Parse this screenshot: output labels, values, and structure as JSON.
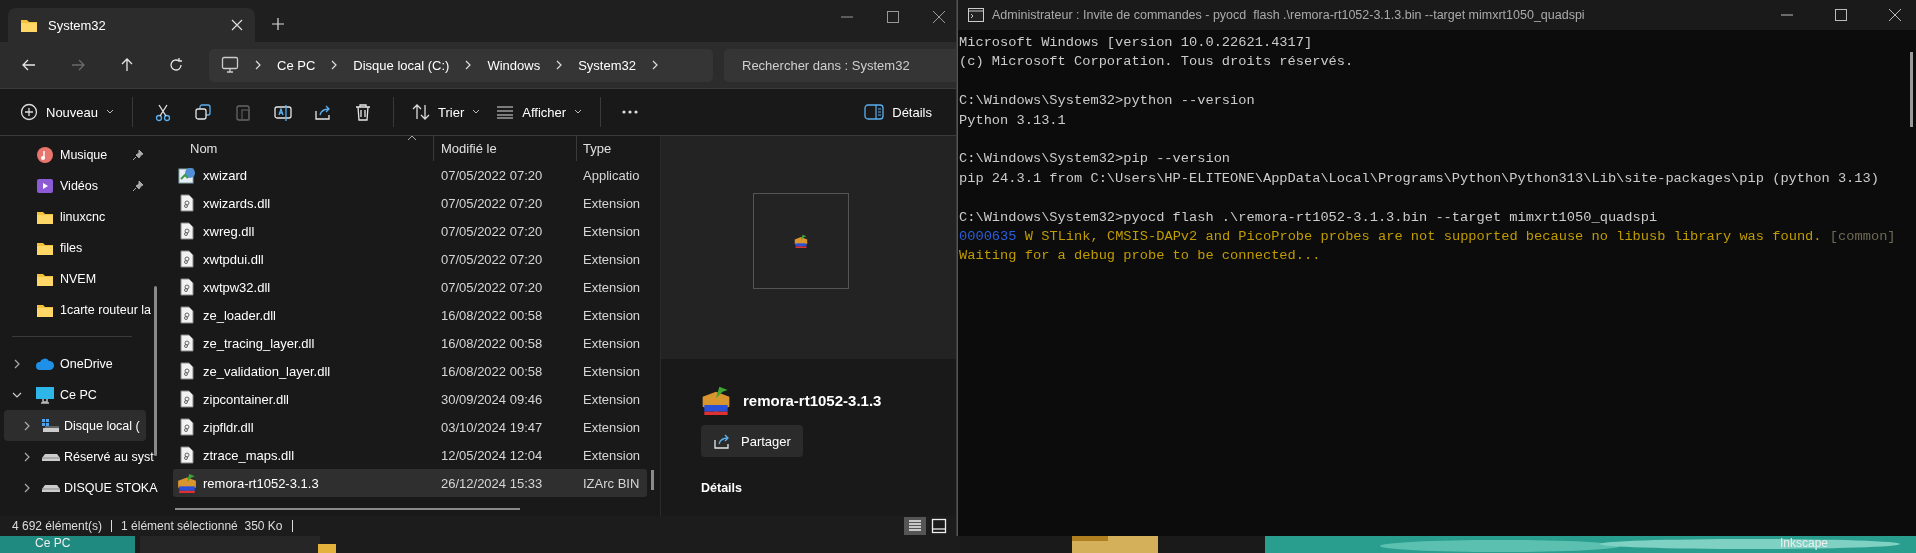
{
  "explorer": {
    "tab": {
      "title": "System32",
      "selected": true
    },
    "nav": [
      {
        "kind": "back",
        "disabled": false
      },
      {
        "kind": "forward",
        "disabled": true
      },
      {
        "kind": "up",
        "disabled": false
      },
      {
        "kind": "refresh",
        "disabled": false
      }
    ],
    "breadcrumb": [
      "Ce PC",
      "Disque local (C:)",
      "Windows",
      "System32"
    ],
    "search": {
      "placeholder": "Rechercher dans : System32"
    },
    "toolbar": {
      "new": "Nouveau",
      "sort": "Trier",
      "view": "Afficher",
      "details": "Détails",
      "actions": [
        {
          "kind": "cut",
          "disabled": false
        },
        {
          "kind": "copy",
          "disabled": false
        },
        {
          "kind": "paste",
          "disabled": true
        },
        {
          "kind": "rename",
          "disabled": false
        },
        {
          "kind": "share",
          "disabled": false
        },
        {
          "kind": "delete",
          "disabled": false
        }
      ]
    },
    "sidebar": {
      "quick_access": [
        {
          "label": "Musique",
          "kind": "music",
          "pinned": true,
          "selected": false
        },
        {
          "label": "Vidéos",
          "kind": "video",
          "pinned": true,
          "selected": false
        },
        {
          "label": "linuxcnc",
          "kind": "folder",
          "pinned": false,
          "selected": false
        },
        {
          "label": "files",
          "kind": "folder",
          "pinned": false,
          "selected": false
        },
        {
          "label": "NVEM",
          "kind": "folder",
          "pinned": false,
          "selected": false
        },
        {
          "label": "1carte routeur la",
          "kind": "folder",
          "pinned": false,
          "selected": false
        }
      ],
      "tree": [
        {
          "label": "OneDrive",
          "kind": "cloud",
          "expanded": false,
          "selected": false
        },
        {
          "label": "Ce PC",
          "kind": "pc",
          "expanded": true,
          "selected": false,
          "children": [
            {
              "label": "Disque local (",
              "kind": "system-drive",
              "expanded": false,
              "selected": true
            },
            {
              "label": "Réservé au syst",
              "kind": "drive",
              "expanded": false,
              "selected": false
            },
            {
              "label": "DISQUE STOKA",
              "kind": "drive",
              "expanded": false,
              "selected": false
            }
          ]
        }
      ]
    },
    "columns": [
      "Nom",
      "Modifié le",
      "Type"
    ],
    "rows": [
      {
        "name": "xwizard",
        "modified": "07/05/2022 07:20",
        "type": "Applicatio",
        "kind": "app",
        "selected": false
      },
      {
        "name": "xwizards.dll",
        "modified": "07/05/2022 07:20",
        "type": "Extension",
        "kind": "dll",
        "selected": false
      },
      {
        "name": "xwreg.dll",
        "modified": "07/05/2022 07:20",
        "type": "Extension",
        "kind": "dll",
        "selected": false
      },
      {
        "name": "xwtpdui.dll",
        "modified": "07/05/2022 07:20",
        "type": "Extension",
        "kind": "dll",
        "selected": false
      },
      {
        "name": "xwtpw32.dll",
        "modified": "07/05/2022 07:20",
        "type": "Extension",
        "kind": "dll",
        "selected": false
      },
      {
        "name": "ze_loader.dll",
        "modified": "16/08/2022 00:58",
        "type": "Extension",
        "kind": "dll",
        "selected": false
      },
      {
        "name": "ze_tracing_layer.dll",
        "modified": "16/08/2022 00:58",
        "type": "Extension",
        "kind": "dll",
        "selected": false
      },
      {
        "name": "ze_validation_layer.dll",
        "modified": "16/08/2022 00:58",
        "type": "Extension",
        "kind": "dll",
        "selected": false
      },
      {
        "name": "zipcontainer.dll",
        "modified": "30/09/2024 09:46",
        "type": "Extension",
        "kind": "dll",
        "selected": false
      },
      {
        "name": "zipfldr.dll",
        "modified": "03/10/2024 19:47",
        "type": "Extension",
        "kind": "dll",
        "selected": false
      },
      {
        "name": "ztrace_maps.dll",
        "modified": "12/05/2024 12:04",
        "type": "Extension",
        "kind": "dll",
        "selected": false
      },
      {
        "name": "remora-rt1052-3.1.3",
        "modified": "26/12/2024 15:33",
        "type": "IZArc BIN",
        "kind": "archive",
        "selected": true
      }
    ],
    "preview": {
      "name": "remora-rt1052-3.1.3",
      "share": "Partager",
      "section": "Détails"
    },
    "status": [
      "4 692 élément(s)",
      "1 élément sélectionné  350 Ko"
    ],
    "views": [
      {
        "kind": "details",
        "selected": true
      },
      {
        "kind": "tiles",
        "selected": false
      }
    ]
  },
  "console": {
    "title": "Administrateur : Invite de commandes - pyocd  flash .\\remora-rt1052-3.1.3.bin --target mimxrt1050_quadspi",
    "lines": [
      {
        "kind": "text",
        "segments": [
          {
            "text": "Microsoft Windows [version 10.0.22621.4317]",
            "color": "#cccccc"
          }
        ]
      },
      {
        "kind": "text",
        "segments": [
          {
            "text": "(c) Microsoft Corporation. Tous droits réservés.",
            "color": "#cccccc"
          }
        ]
      },
      {
        "kind": "blank"
      },
      {
        "kind": "text",
        "segments": [
          {
            "text": "C:\\Windows\\System32>python --version",
            "color": "#cccccc"
          }
        ]
      },
      {
        "kind": "text",
        "segments": [
          {
            "text": "Python 3.13.1",
            "color": "#cccccc"
          }
        ]
      },
      {
        "kind": "blank"
      },
      {
        "kind": "text",
        "segments": [
          {
            "text": "C:\\Windows\\System32>pip --version",
            "color": "#cccccc"
          }
        ]
      },
      {
        "kind": "text",
        "segments": [
          {
            "text": "pip 24.3.1 from C:\\Users\\HP-ELITEONE\\AppData\\Local\\Programs\\Python\\Python313\\Lib\\site-packages\\pip (python 3.13)",
            "color": "#cccccc"
          }
        ]
      },
      {
        "kind": "blank"
      },
      {
        "kind": "text",
        "segments": [
          {
            "text": "C:\\Windows\\System32>pyocd flash .\\remora-rt1052-3.1.3.bin --target mimxrt1050_quadspi",
            "color": "#cccccc"
          }
        ]
      },
      {
        "kind": "text",
        "segments": [
          {
            "text": "0000635",
            "color": "#2a5fe0"
          },
          {
            "text": "W STLink, CMSIS-DAPv2 and PicoProbe probes are not supported because no libusb library was found.",
            "color": "#c19c00"
          },
          {
            "text": "[common]",
            "color": "#6e6a55"
          }
        ]
      },
      {
        "kind": "text",
        "segments": [
          {
            "text": "Waiting for a debug probe to be connected...",
            "color": "#c19c00"
          }
        ]
      }
    ]
  },
  "desktop": {
    "labels": [
      "Ce PC",
      "Inkscape"
    ]
  }
}
